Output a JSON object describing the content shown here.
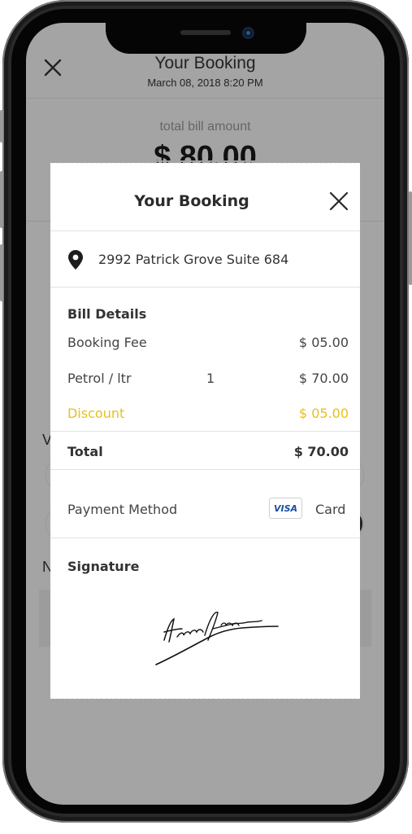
{
  "background": {
    "title": "Your Booking",
    "datetime": "March 08, 2018 8:20 PM",
    "total_label": "total bill amount",
    "total_value": "$ 80.00",
    "letter_w": "V",
    "letter_n": "N"
  },
  "modal": {
    "title": "Your Booking",
    "address": "2992 Patrick Grove Suite 684",
    "bill_details_heading": "Bill Details",
    "items": [
      {
        "label": "Booking Fee",
        "qty": "",
        "value": "$ 05.00"
      },
      {
        "label": "Petrol / ltr",
        "qty": "1",
        "value": "$ 70.00"
      },
      {
        "label": "Discount",
        "qty": "",
        "value": "$ 05.00"
      }
    ],
    "total_label": "Total",
    "total_value": "$ 70.00",
    "payment_label": "Payment Method",
    "payment_brand": "VISA",
    "payment_type": "Card",
    "signature_heading": "Signature"
  },
  "colors": {
    "accent_discount": "#e6c21c",
    "overlay": "#a4a4a4"
  },
  "icons": [
    "close-icon",
    "location-pin-icon",
    "visa-card-icon"
  ]
}
